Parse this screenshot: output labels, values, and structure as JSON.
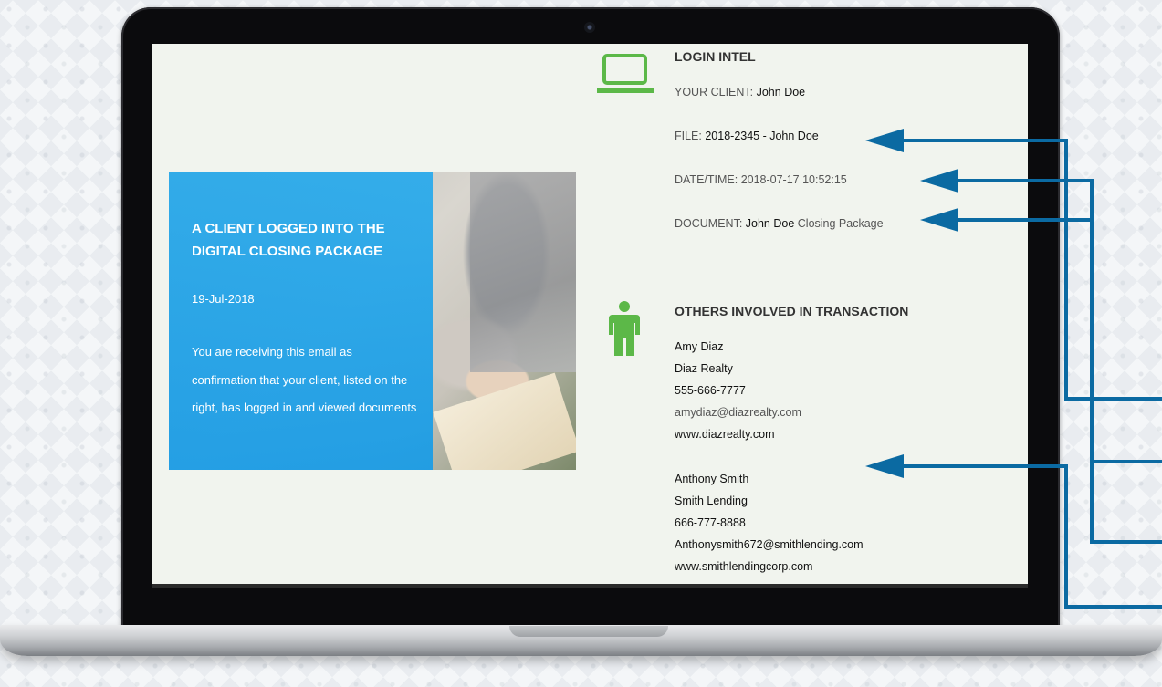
{
  "card": {
    "title": "A CLIENT LOGGED INTO THE DIGITAL CLOSING PACKAGE",
    "date": "19-Jul-2018",
    "body": "You are receiving this email as confirmation that your client, listed on the right, has logged in and viewed documents"
  },
  "login_intel": {
    "heading": "LOGIN INTEL",
    "client_label": "YOUR CLIENT: ",
    "client_value": "John Doe",
    "file_label": "FILE: ",
    "file_value": "2018-2345 - John Doe",
    "datetime_label": "DATE/TIME: ",
    "datetime_value": "2018-07-17 10:52:15",
    "document_label": "DOCUMENT: ",
    "document_value": "John Doe",
    "document_suffix": " Closing Package"
  },
  "others": {
    "heading": "OTHERS INVOLVED IN TRANSACTION",
    "contacts": [
      {
        "name": "Amy Diaz",
        "company": "Diaz Realty",
        "phone": "555-666-7777",
        "email": "amydiaz@diazrealty.com",
        "website": "www.diazrealty.com"
      },
      {
        "name": "Anthony Smith",
        "company": "Smith Lending",
        "phone": "666-777-8888",
        "email": "Anthonysmith672@smithlending.com",
        "website": "www.smithlendingcorp.com"
      }
    ]
  },
  "colors": {
    "accent_blue": "#1e9ee6",
    "icon_green": "#5cb848",
    "arrow_blue": "#0b6aa2",
    "screen_bg": "#f1f4ee"
  },
  "icons": [
    "laptop-icon",
    "person-icon"
  ]
}
